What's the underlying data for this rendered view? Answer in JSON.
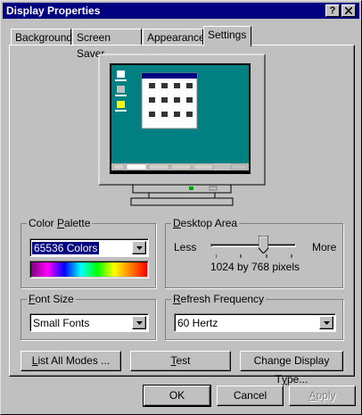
{
  "window": {
    "title": "Display Properties"
  },
  "tabs": [
    {
      "label": "Background"
    },
    {
      "label": "Screen Saver"
    },
    {
      "label": "Appearance"
    },
    {
      "label": "Settings"
    }
  ],
  "color_palette": {
    "label_pre": "Color ",
    "label_key": "P",
    "label_post": "alette",
    "value": "65536 Colors"
  },
  "desktop_area": {
    "label_pre": "",
    "label_key": "D",
    "label_post": "esktop Area",
    "less": "Less",
    "more": "More",
    "resolution": "1024 by 768 pixels",
    "slider_level": 0.62
  },
  "font_size": {
    "label_pre": "",
    "label_key": "F",
    "label_post": "ont Size",
    "value": "Small Fonts"
  },
  "refresh_frequency": {
    "label_pre": "",
    "label_key": "R",
    "label_post": "efresh Frequency",
    "value": "60 Hertz"
  },
  "buttons": {
    "list_all_modes": {
      "key": "L",
      "rest": "ist All Modes ..."
    },
    "test": {
      "key": "T",
      "rest": "est"
    },
    "change_display": {
      "pre": "Change Display T",
      "key": "y",
      "rest": "pe..."
    },
    "ok": "OK",
    "cancel": "Cancel",
    "apply": {
      "key": "A",
      "rest": "pply"
    }
  },
  "colors": {
    "titlebar": "#000080",
    "desktop": "#008080",
    "face": "#c0c0c0"
  }
}
